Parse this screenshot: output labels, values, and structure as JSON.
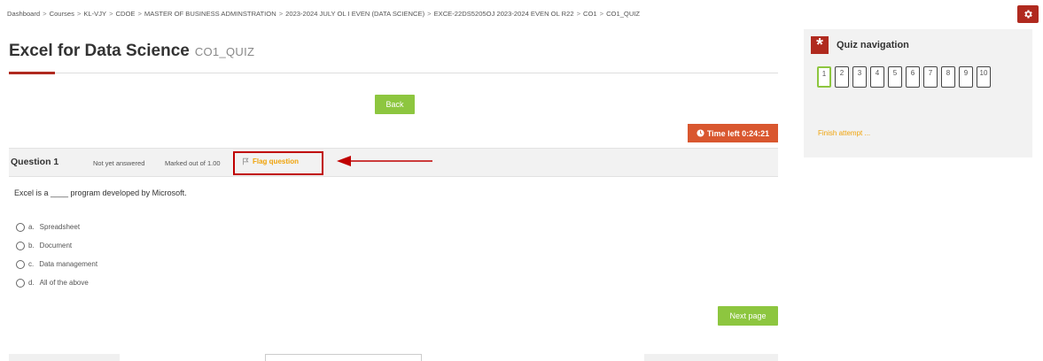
{
  "breadcrumb": [
    "Dashboard",
    "Courses",
    "KL-VJY",
    "CDOE",
    "MASTER OF BUSINESS ADMINSTRATION",
    "2023-2024 JULY OL I EVEN (DATA SCIENCE)",
    "EXCE-22DS5205OJ 2023-2024 EVEN OL R22",
    "CO1",
    "CO1_QUIZ"
  ],
  "header": {
    "title": "Excel for Data Science",
    "subtitle": "CO1_QUIZ"
  },
  "back_label": "Back",
  "timer": {
    "label": "Time left 0:24:21"
  },
  "question": {
    "title": "Question 1",
    "state": "Not yet answered",
    "marks": "Marked out of 1.00",
    "flag_label": "Flag question",
    "text": "Excel is a ____ program developed by Microsoft.",
    "answers": [
      {
        "letter": "a.",
        "text": "Spreadsheet"
      },
      {
        "letter": "b.",
        "text": "Document"
      },
      {
        "letter": "c.",
        "text": "Data management"
      },
      {
        "letter": "d.",
        "text": "All of the above"
      }
    ]
  },
  "next_label": "Next page",
  "nav": {
    "title": "Quiz navigation",
    "buttons": [
      "1",
      "2",
      "3",
      "4",
      "5",
      "6",
      "7",
      "8",
      "9",
      "10"
    ],
    "finish": "Finish attempt ..."
  },
  "colors": {
    "brand": "#b02a1f",
    "green": "#8dc63f",
    "timer": "#d9572f",
    "link": "#f0a30a",
    "highlight": "#c00000"
  },
  "icons": {
    "settings": "gear-icon",
    "timer": "clock-icon",
    "flag": "flag-icon",
    "nav": "asterisk-icon"
  }
}
